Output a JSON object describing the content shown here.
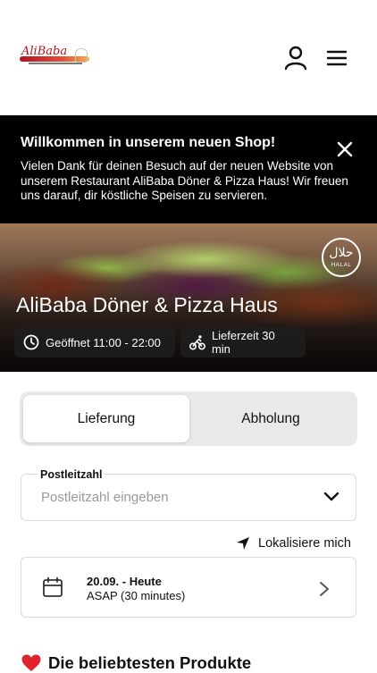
{
  "header": {
    "logo_text": "AliBaba",
    "icons": {
      "account": "user-icon",
      "menu": "hamburger-menu-icon"
    }
  },
  "notice": {
    "title": "Willkommen in unserem neuen Shop!",
    "text": "Vielen Dank für deinen Besuch auf der neuen Website von unserem Restaurant AliBaba Döner & Pizza Haus! Wir freuen uns darauf, dir köstliche Speisen zu servieren.",
    "close_icon": "close-icon"
  },
  "hero": {
    "restaurant_name": "AliBaba Döner & Pizza Haus",
    "halal_badge": {
      "arabic": "حلال",
      "latin": "HALAL"
    },
    "opening_hours": "Geöffnet 11:00 - 22:00",
    "delivery_time": "Lieferzeit 30 min"
  },
  "order_mode": {
    "options": [
      "Lieferung",
      "Abholung"
    ],
    "selected": "Lieferung"
  },
  "postal_code": {
    "label": "Postleitzahl",
    "placeholder": "Postleitzahl eingeben",
    "value": ""
  },
  "locate": {
    "label": "Lokalisiere mich"
  },
  "schedule": {
    "date": "20.09. - Heute",
    "time": "ASAP (30 minutes)"
  },
  "popular": {
    "heading": "Die beliebtesten Produkte"
  },
  "colors": {
    "brand": "#b3141c",
    "notice_bg": "#000000",
    "segment_bg": "#e9e9e9",
    "heart": "#e0242e"
  }
}
